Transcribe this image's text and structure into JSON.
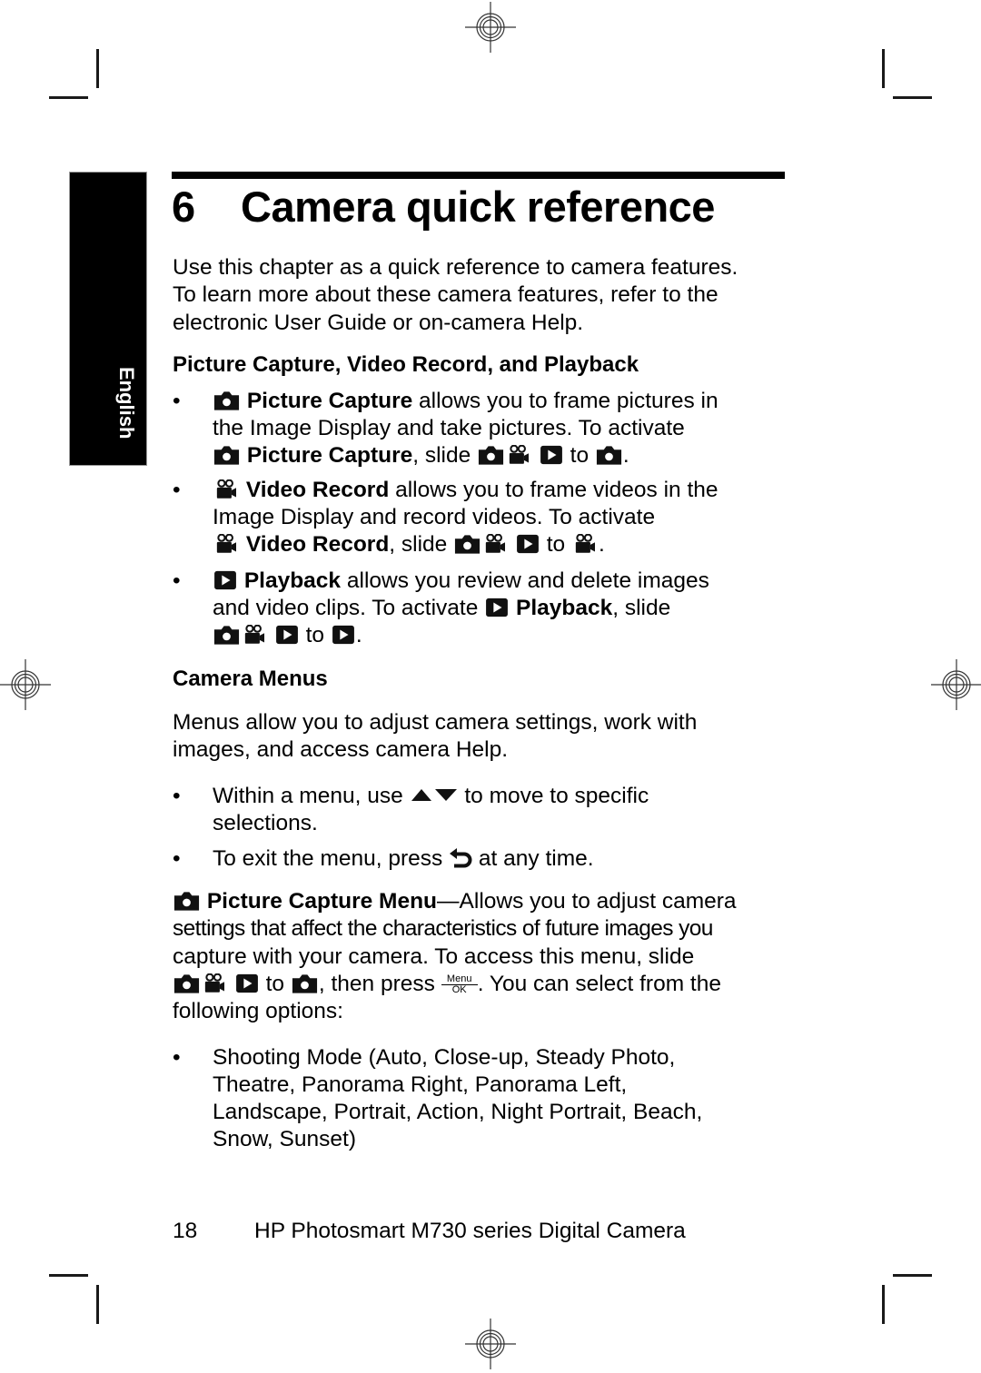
{
  "side_tab": {
    "label": "English"
  },
  "chapter": {
    "number": "6",
    "title": "Camera quick reference"
  },
  "intro": {
    "lines": [
      "Use this chapter as a quick reference to camera features.",
      "To learn more about these camera features, refer to the",
      "electronic User Guide or on-camera Help."
    ]
  },
  "section1": {
    "heading": "Picture Capture, Video Record, and Playback",
    "items": [
      {
        "mode": "Picture Capture",
        "line1_rest": " allows you to frame pictures in",
        "line2": "the Image Display and take pictures. To activate",
        "line3_mode": "Picture Capture",
        "line3_mid": ", slide ",
        "to": " to ",
        "end": "."
      },
      {
        "mode": "Video Record",
        "line1_rest": " allows you to frame videos in the",
        "line2": "Image Display and record videos. To activate",
        "line3_mode": "Video Record",
        "line3_mid": ", slide ",
        "to": " to ",
        "end": "."
      },
      {
        "mode": "Playback",
        "line1_rest": " allows you review and delete images",
        "line2_start": "and video clips. To activate ",
        "line2_mode": "Playback",
        "line2_end": ", slide",
        "to": " to ",
        "end": "."
      }
    ],
    "bullet": "•"
  },
  "section2": {
    "heading": "Camera Menus",
    "intro_lines": [
      "Menus allow you to adjust camera settings, work with",
      "images, and access camera Help."
    ],
    "bullets": [
      {
        "before": "Within a menu, use ",
        "after": " to move to specific",
        "line2": "selections."
      },
      {
        "before": "To exit the menu, press ",
        "after": " at any time."
      }
    ]
  },
  "capture_menu": {
    "title": "Picture Capture Menu",
    "line1_rest": "—Allows you to adjust camera",
    "line2": "settings that affect the characteristics of future images you",
    "line3": "capture with your camera. To access this menu, slide",
    "line4_to": " to ",
    "line4_mid": ", then press ",
    "menu_button": {
      "top": "Menu",
      "bottom": "OK"
    },
    "line4_end": ". You can select from the",
    "line5": "following options:",
    "options": [
      {
        "lines": [
          "Shooting Mode (Auto, Close-up, Steady Photo,",
          "Theatre, Panorama Right, Panorama Left,",
          "Landscape, Portrait, Action, Night Portrait, Beach,",
          "Snow, Sunset)"
        ]
      }
    ]
  },
  "footer": {
    "page_number": "18",
    "product": "HP Photosmart M730 series Digital Camera"
  },
  "icons": {
    "camera": "camera-icon",
    "video": "video-camera-icon",
    "playback": "play-icon",
    "updown": "up-down-arrows-icon",
    "back": "back-arrow-icon",
    "menu_ok": "menu-ok-button-icon"
  }
}
